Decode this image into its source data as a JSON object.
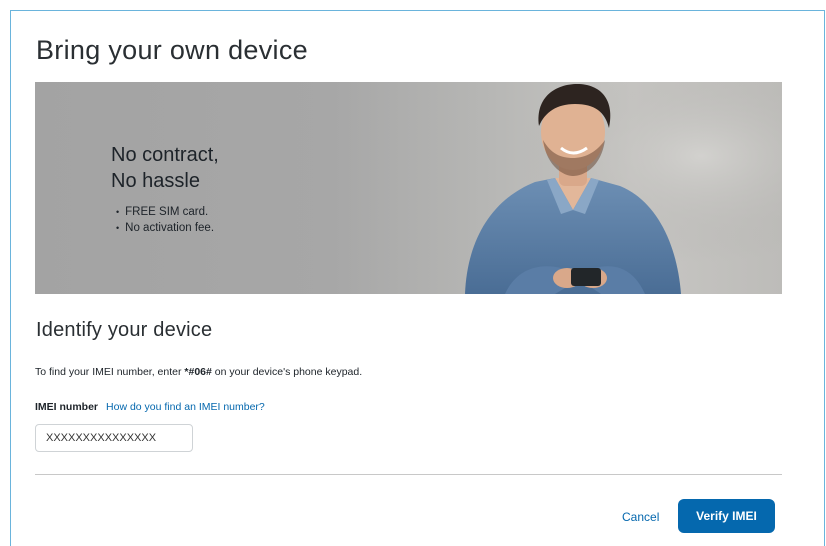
{
  "modal": {
    "title": "Bring your own device"
  },
  "hero": {
    "headline_line1": "No contract,",
    "headline_line2": "No hassle",
    "bullets": [
      "FREE SIM card.",
      "No activation fee."
    ]
  },
  "identify": {
    "title": "Identify your device",
    "instruction_prefix": "To find your IMEI number, enter ",
    "instruction_code": "*#06#",
    "instruction_suffix": " on your device's phone keypad.",
    "imei_label": "IMEI number",
    "help_link": "How do you find an IMEI number?",
    "imei_value": "XXXXXXXXXXXXXXX"
  },
  "actions": {
    "cancel_label": "Cancel",
    "verify_label": "Verify IMEI"
  },
  "colors": {
    "accent": "#0568ae",
    "border": "#6ab4dc"
  }
}
